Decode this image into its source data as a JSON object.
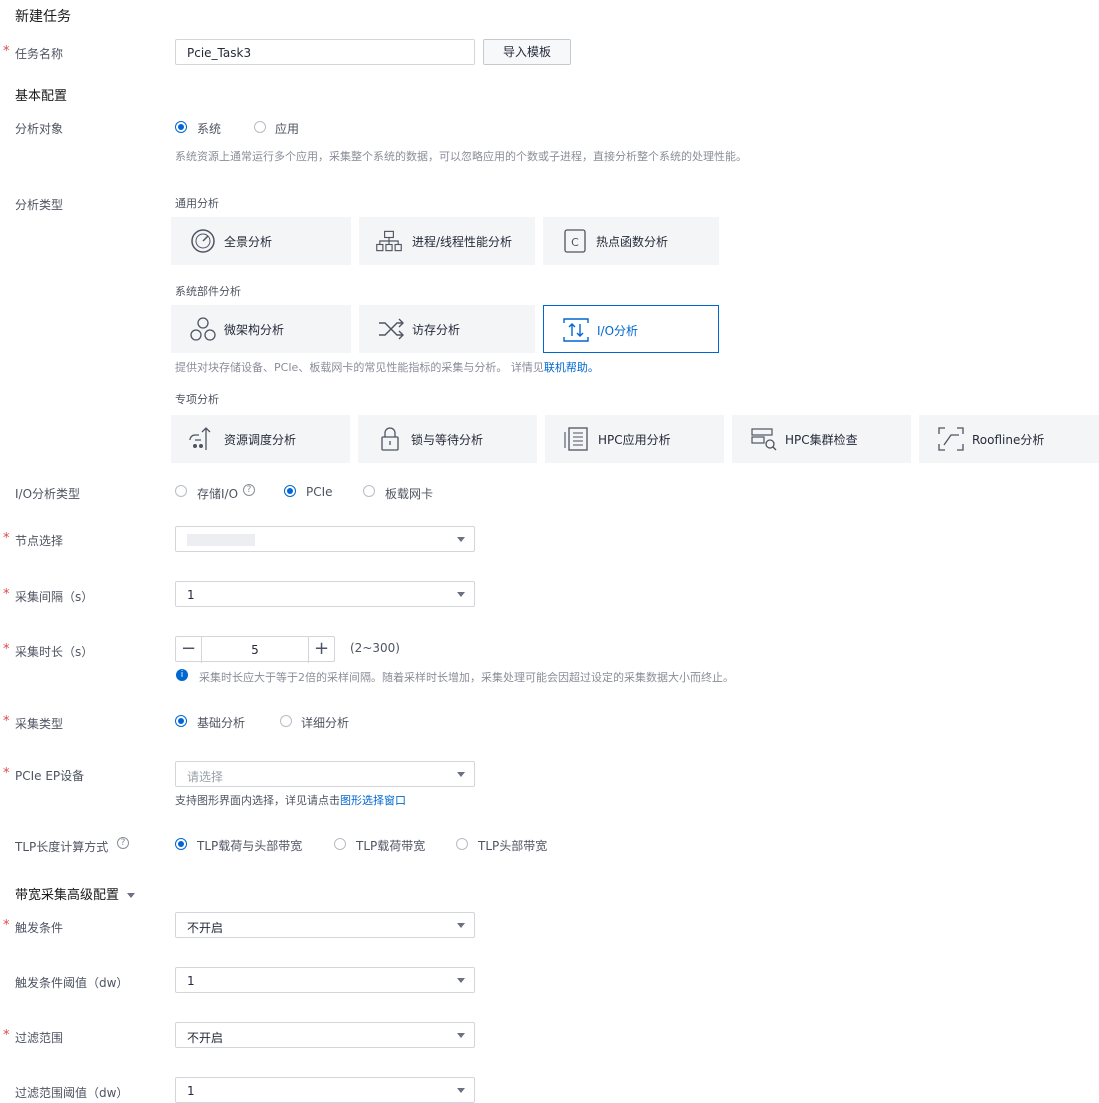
{
  "page_title": "新建任务",
  "task_name": {
    "label": "任务名称",
    "value": "Pcie_Task3",
    "import_button": "导入模板"
  },
  "basic_config": {
    "heading": "基本配置"
  },
  "analysis_object": {
    "label": "分析对象",
    "options": [
      "系统",
      "应用"
    ],
    "selected": "系统",
    "description": "系统资源上通常运行多个应用，采集整个系统的数据，可以忽略应用的个数或子进程，直接分析整个系统的处理性能。"
  },
  "analysis_type": {
    "label": "分析类型",
    "general": {
      "heading": "通用分析",
      "cards": [
        "全景分析",
        "进程/线程性能分析",
        "热点函数分析"
      ]
    },
    "system": {
      "heading": "系统部件分析",
      "cards": [
        "微架构分析",
        "访存分析",
        "I/O分析"
      ],
      "selected": "I/O分析"
    },
    "system_desc": "提供对块存储设备、PCIe、板载网卡的常见性能指标的采集与分析。 详情见",
    "system_desc_link": "联机帮助。",
    "special": {
      "heading": "专项分析",
      "cards": [
        "资源调度分析",
        "锁与等待分析",
        "HPC应用分析",
        "HPC集群检查",
        "Roofline分析"
      ]
    }
  },
  "io_type": {
    "label": "I/O分析类型",
    "options": [
      "存储I/O",
      "PCIe",
      "板载网卡"
    ],
    "selected": "PCIe"
  },
  "node": {
    "label": "节点选择",
    "value": ""
  },
  "interval": {
    "label": "采集间隔（s）",
    "value": "1"
  },
  "duration": {
    "label": "采集时长（s）",
    "value": "5",
    "range": "(2~300)",
    "hint": "采集时长应大于等于2倍的采样间隔。随着采样时长增加，采集处理可能会因超过设定的采集数据大小而终止。"
  },
  "collect_type": {
    "label": "采集类型",
    "options": [
      "基础分析",
      "详细分析"
    ],
    "selected": "基础分析"
  },
  "pcie_ep": {
    "label": "PCIe EP设备",
    "placeholder": "请选择",
    "hint": "支持图形界面内选择，详见请点击",
    "hint_link": "图形选择窗口"
  },
  "tlp": {
    "label": "TLP长度计算方式",
    "options": [
      "TLP载荷与头部带宽",
      "TLP载荷带宽",
      "TLP头部带宽"
    ],
    "selected": "TLP载荷与头部带宽"
  },
  "advanced": {
    "heading": "带宽采集高级配置"
  },
  "trigger": {
    "label": "触发条件",
    "value": "不开启"
  },
  "trigger_threshold": {
    "label": "触发条件阈值（dw）",
    "value": "1"
  },
  "filter": {
    "label": "过滤范围",
    "value": "不开启"
  },
  "filter_threshold": {
    "label": "过滤范围阈值（dw）",
    "value": "1"
  },
  "colors": {
    "accent": "#0067d1",
    "required": "#e54545",
    "card_bg": "#f4f5f7"
  }
}
